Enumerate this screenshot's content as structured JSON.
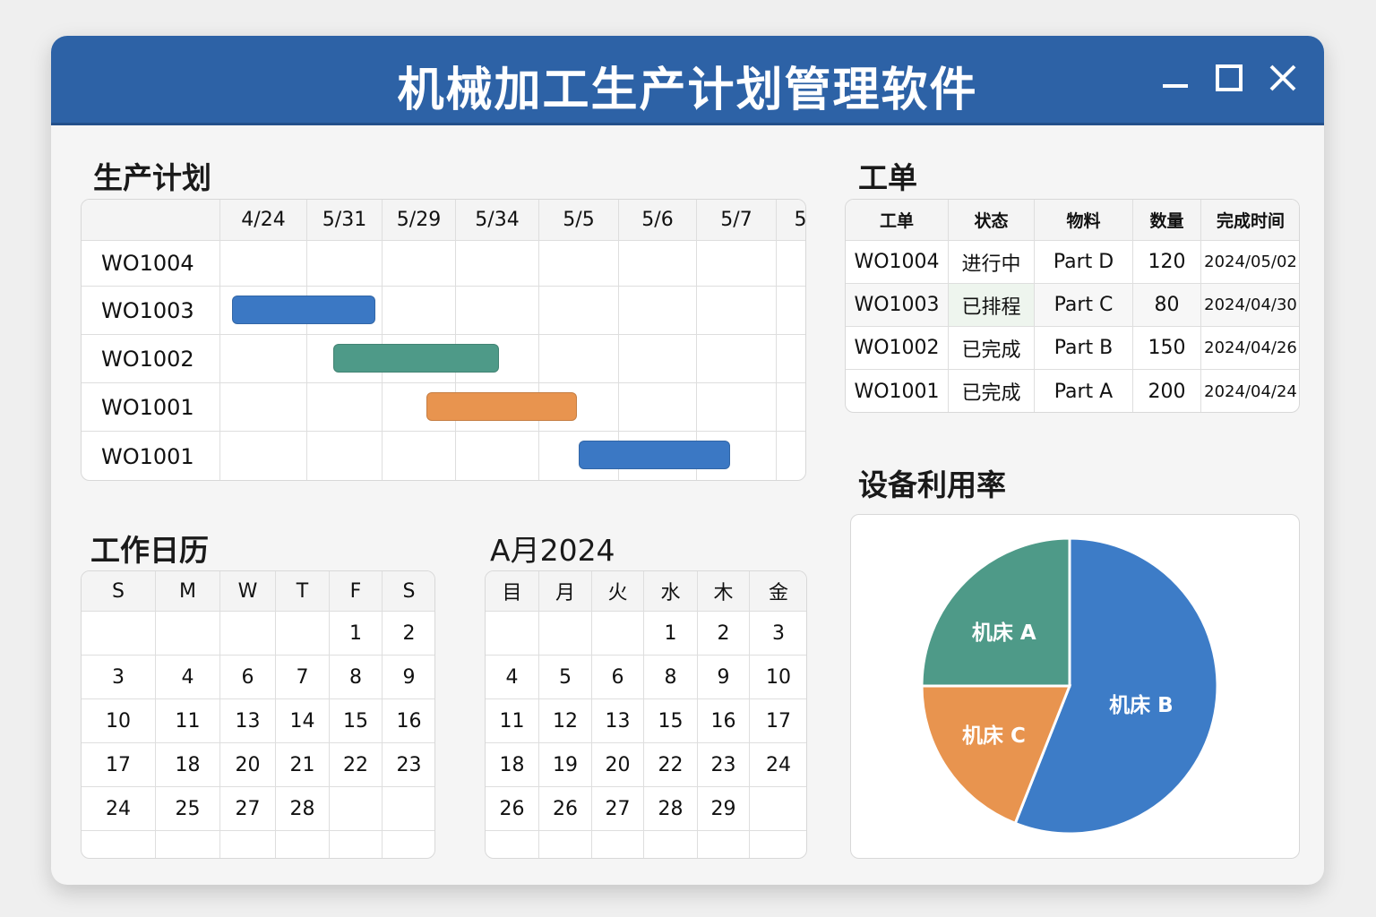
{
  "window": {
    "title": "机械加工生产计划管理软件"
  },
  "gantt": {
    "title": "生产计划",
    "dates": [
      "4/24",
      "5/31",
      "5/29",
      "5/34",
      "5/5",
      "5/6",
      "5/7",
      "5"
    ],
    "rows": [
      "WO1004",
      "WO1003",
      "WO1002",
      "WO1001",
      "WO1001"
    ],
    "bars": [
      {
        "row": 1,
        "start": 0.13,
        "end": 1.9,
        "color": "#3b78c4"
      },
      {
        "row": 2,
        "start": 1.35,
        "end": 3.52,
        "color": "#4e9a88"
      },
      {
        "row": 3,
        "start": 2.6,
        "end": 4.47,
        "color": "#e8944f"
      },
      {
        "row": 4,
        "start": 4.49,
        "end": 6.42,
        "color": "#3b78c4"
      }
    ]
  },
  "workorders": {
    "title": "工单",
    "headers": [
      "工单",
      "状态",
      "物料",
      "数量",
      "完成时间"
    ],
    "rows": [
      [
        "WO1004",
        "进行中",
        "Part D",
        "120",
        "2024/05/02"
      ],
      [
        "WO1003",
        "已排程",
        "Part C",
        "80",
        "2024/04/30"
      ],
      [
        "WO1002",
        "已完成",
        "Part B",
        "150",
        "2024/04/26"
      ],
      [
        "WO1001",
        "已完成",
        "Part A",
        "200",
        "2024/04/24"
      ]
    ]
  },
  "calendar1": {
    "title": "工作日历",
    "headers": [
      "S",
      "M",
      "W",
      "T",
      "F",
      "S"
    ],
    "rows": [
      [
        "",
        "",
        "",
        "",
        "1",
        "2"
      ],
      [
        "3",
        "4",
        "6",
        "7",
        "8",
        "9"
      ],
      [
        "10",
        "11",
        "13",
        "14",
        "15",
        "16"
      ],
      [
        "17",
        "18",
        "20",
        "21",
        "22",
        "23"
      ],
      [
        "24",
        "25",
        "27",
        "28",
        "",
        ""
      ],
      [
        "",
        "",
        "",
        "",
        "",
        ""
      ]
    ]
  },
  "calendar2": {
    "title": "A月2024",
    "headers": [
      "目",
      "月",
      "火",
      "水",
      "木",
      "金"
    ],
    "rows": [
      [
        "",
        "",
        "",
        "1",
        "2",
        "3"
      ],
      [
        "4",
        "5",
        "6",
        "8",
        "9",
        "10"
      ],
      [
        "11",
        "12",
        "13",
        "15",
        "16",
        "17"
      ],
      [
        "18",
        "19",
        "20",
        "22",
        "23",
        "24"
      ],
      [
        "26",
        "26",
        "27",
        "28",
        "29",
        ""
      ],
      [
        "",
        "",
        "",
        "",
        "",
        ""
      ]
    ]
  },
  "utilization": {
    "title": "设备利用率",
    "chart_data": {
      "type": "pie",
      "slices": [
        {
          "label": "机床 B",
          "value": 56,
          "color": "#3d7cc7"
        },
        {
          "label": "机床 C",
          "value": 19,
          "color": "#e8944f"
        },
        {
          "label": "机床 A",
          "value": 25,
          "color": "#4e9a88"
        }
      ]
    }
  }
}
